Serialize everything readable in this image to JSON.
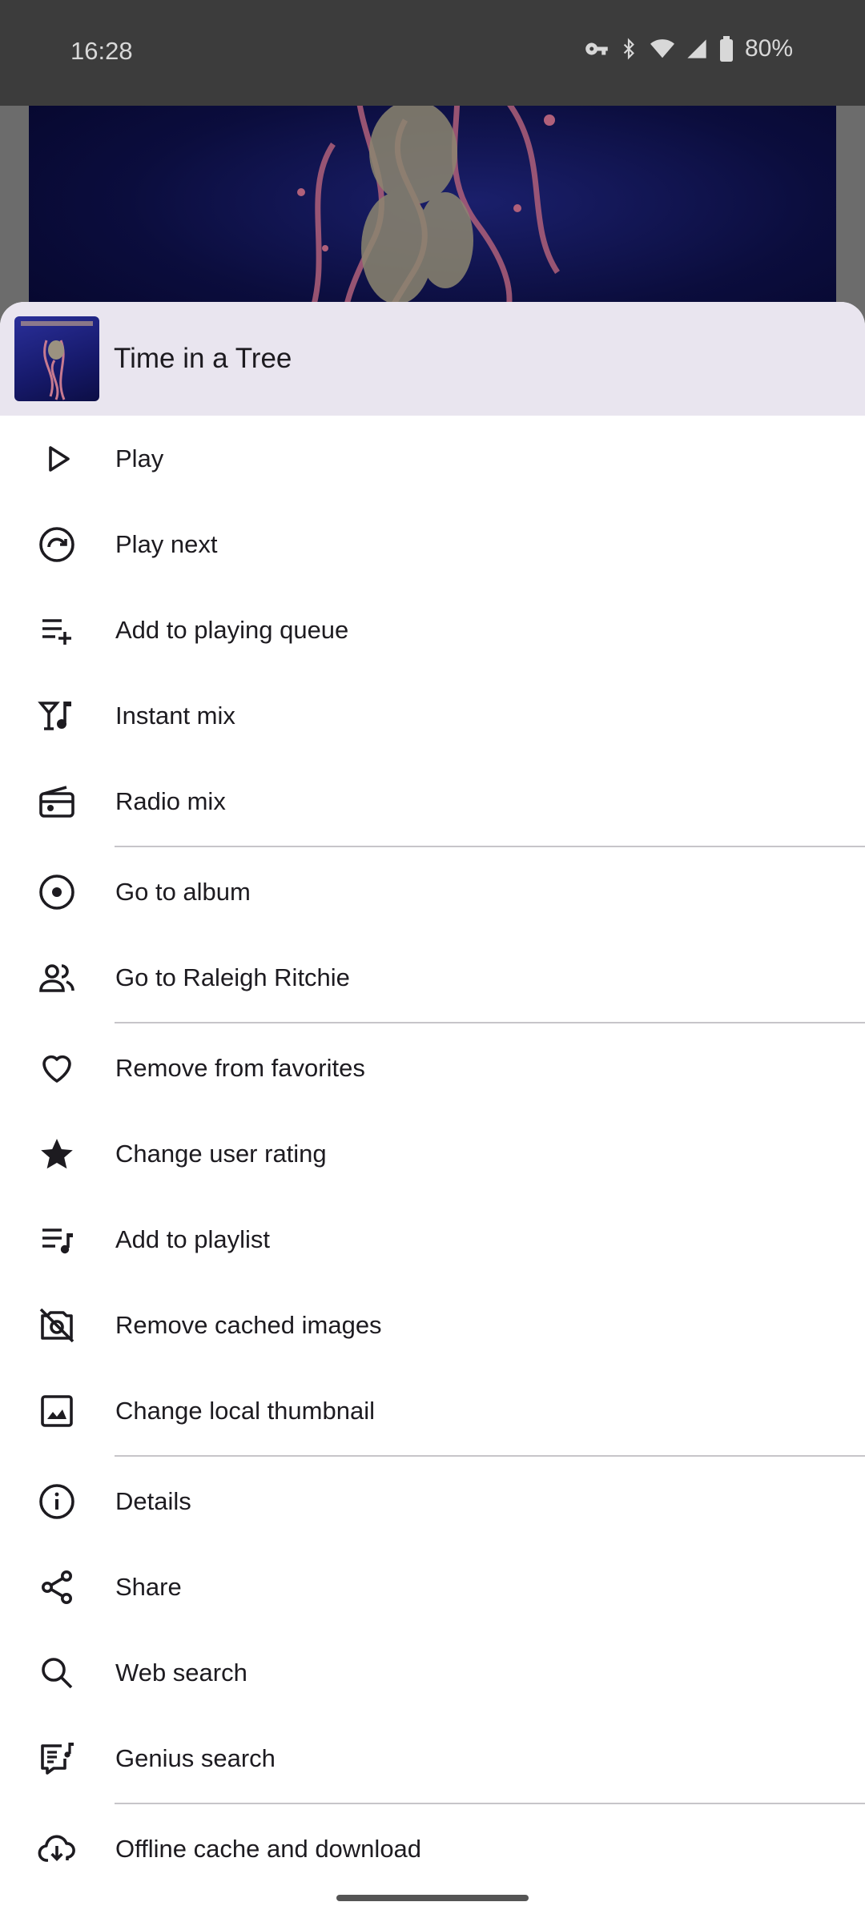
{
  "status_bar": {
    "time": "16:28",
    "battery": "80%"
  },
  "sheet": {
    "title": "Time in a Tree"
  },
  "menu": [
    {
      "label": "Play",
      "icon": "play-icon"
    },
    {
      "label": "Play next",
      "icon": "play-next-icon"
    },
    {
      "label": "Add to playing queue",
      "icon": "queue-add-icon"
    },
    {
      "label": "Instant mix",
      "icon": "instant-mix-icon"
    },
    {
      "label": "Radio mix",
      "icon": "radio-icon"
    },
    {
      "label": "Go to album",
      "icon": "album-icon"
    },
    {
      "label": "Go to Raleigh Ritchie",
      "icon": "artist-icon"
    },
    {
      "label": "Remove from favorites",
      "icon": "heart-icon"
    },
    {
      "label": "Change user rating",
      "icon": "star-icon"
    },
    {
      "label": "Add to playlist",
      "icon": "playlist-add-icon"
    },
    {
      "label": "Remove cached images",
      "icon": "no-photo-icon"
    },
    {
      "label": "Change local thumbnail",
      "icon": "image-icon"
    },
    {
      "label": "Details",
      "icon": "info-icon"
    },
    {
      "label": "Share",
      "icon": "share-icon"
    },
    {
      "label": "Web search",
      "icon": "search-icon"
    },
    {
      "label": "Genius search",
      "icon": "lyrics-icon"
    },
    {
      "label": "Offline cache and download",
      "icon": "cloud-download-icon"
    }
  ],
  "colors": {
    "sheet_header_bg": "#e9e5ef",
    "text": "#1d1b20",
    "divider": "#c7c5c9"
  }
}
